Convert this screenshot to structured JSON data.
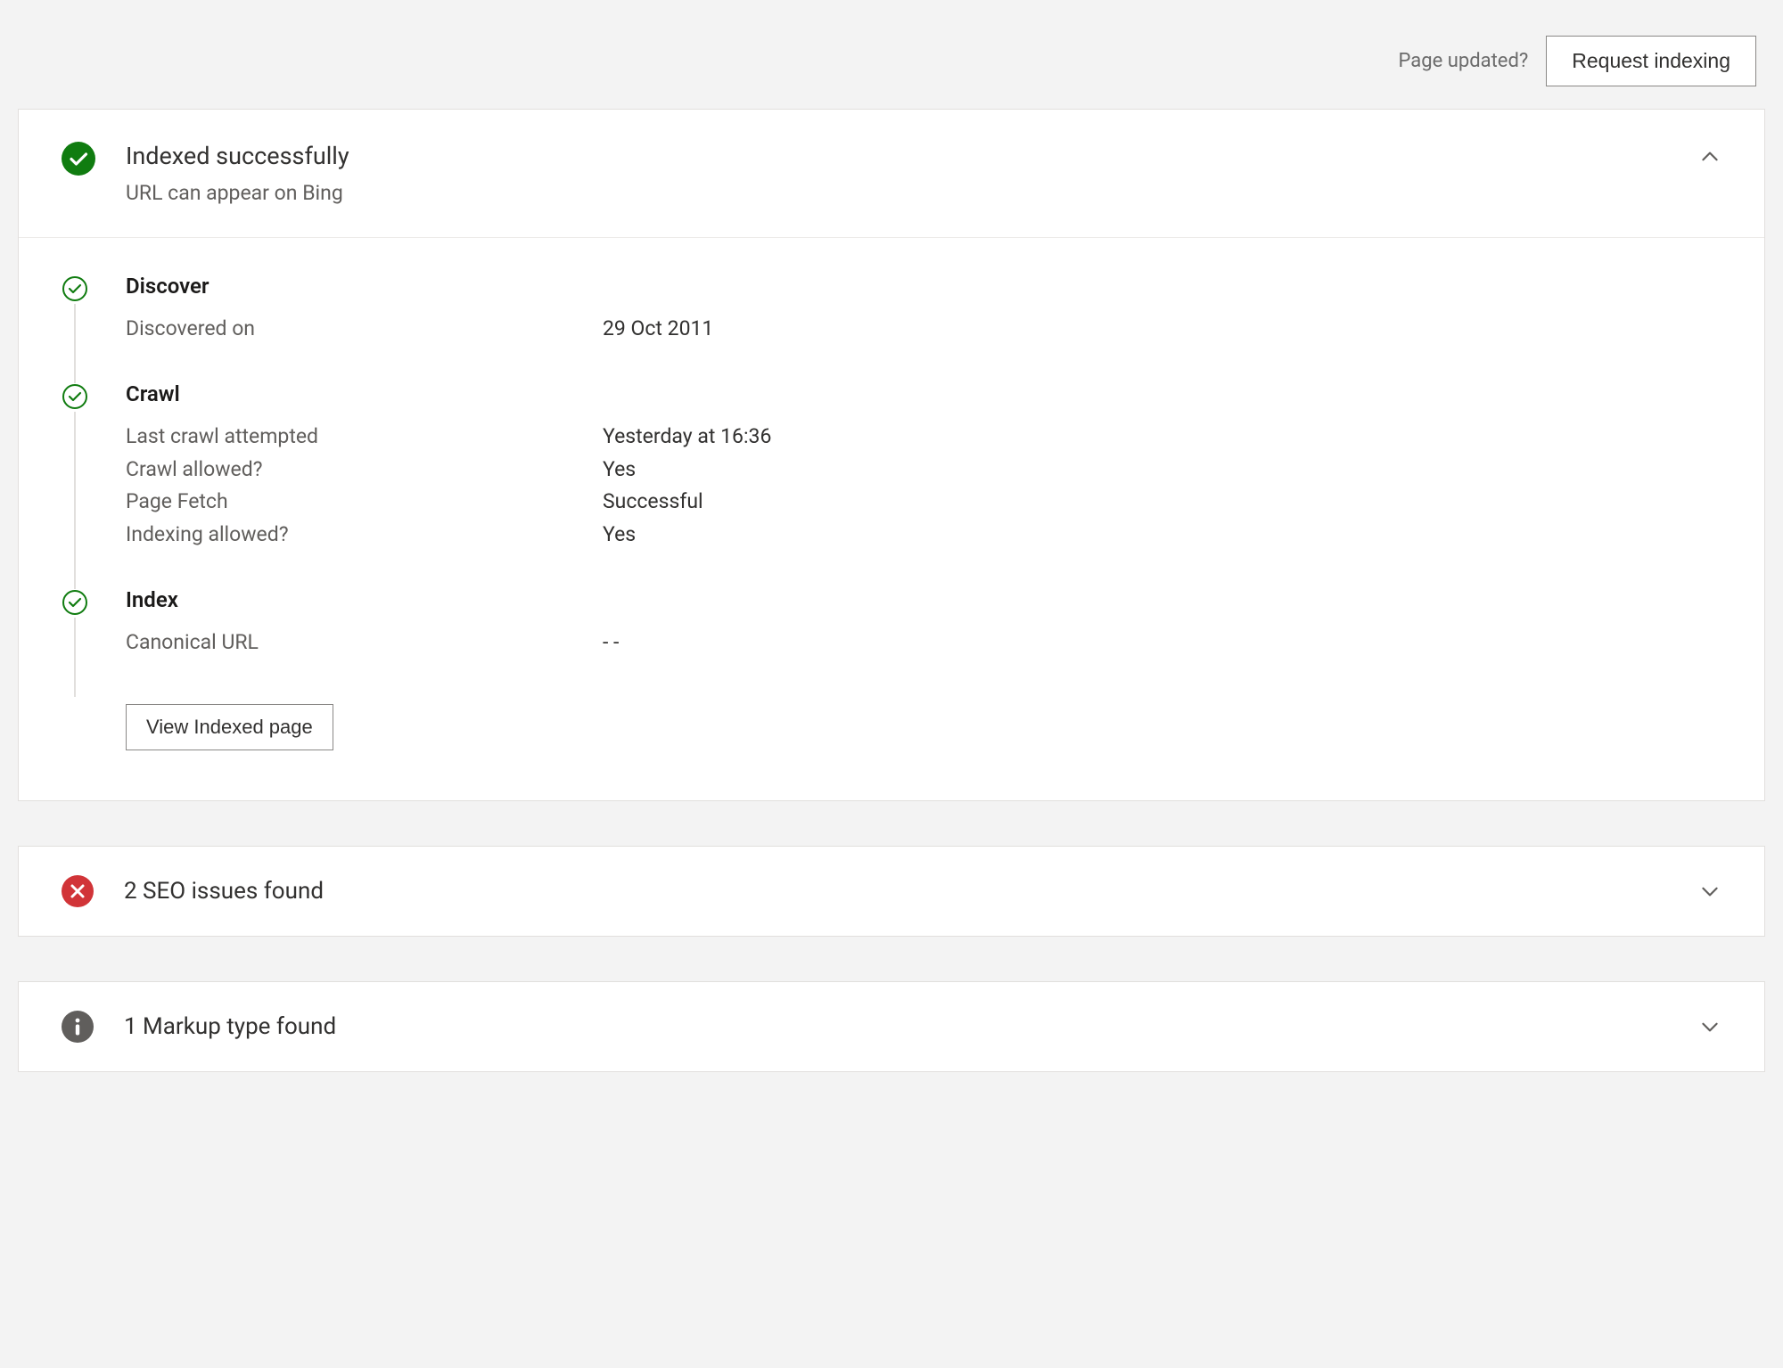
{
  "topbar": {
    "hint": "Page updated?",
    "request_indexing_label": "Request indexing"
  },
  "status_card": {
    "title": "Indexed successfully",
    "subtitle": "URL can appear on Bing"
  },
  "discover": {
    "title": "Discover",
    "discovered_on_label": "Discovered on",
    "discovered_on_value": "29 Oct 2011"
  },
  "crawl": {
    "title": "Crawl",
    "last_attempt_label": "Last crawl attempted",
    "last_attempt_value": "Yesterday at 16:36",
    "crawl_allowed_label": "Crawl allowed?",
    "crawl_allowed_value": "Yes",
    "page_fetch_label": "Page Fetch",
    "page_fetch_value": "Successful",
    "indexing_allowed_label": "Indexing allowed?",
    "indexing_allowed_value": "Yes"
  },
  "index": {
    "title": "Index",
    "canonical_label": "Canonical URL",
    "canonical_value": "- -",
    "view_indexed_label": "View Indexed page"
  },
  "seo_card": {
    "title": "2 SEO issues found"
  },
  "markup_card": {
    "title": "1 Markup type found"
  },
  "colors": {
    "success": "#107c10",
    "error": "#d13438",
    "info": "#605e5c"
  }
}
